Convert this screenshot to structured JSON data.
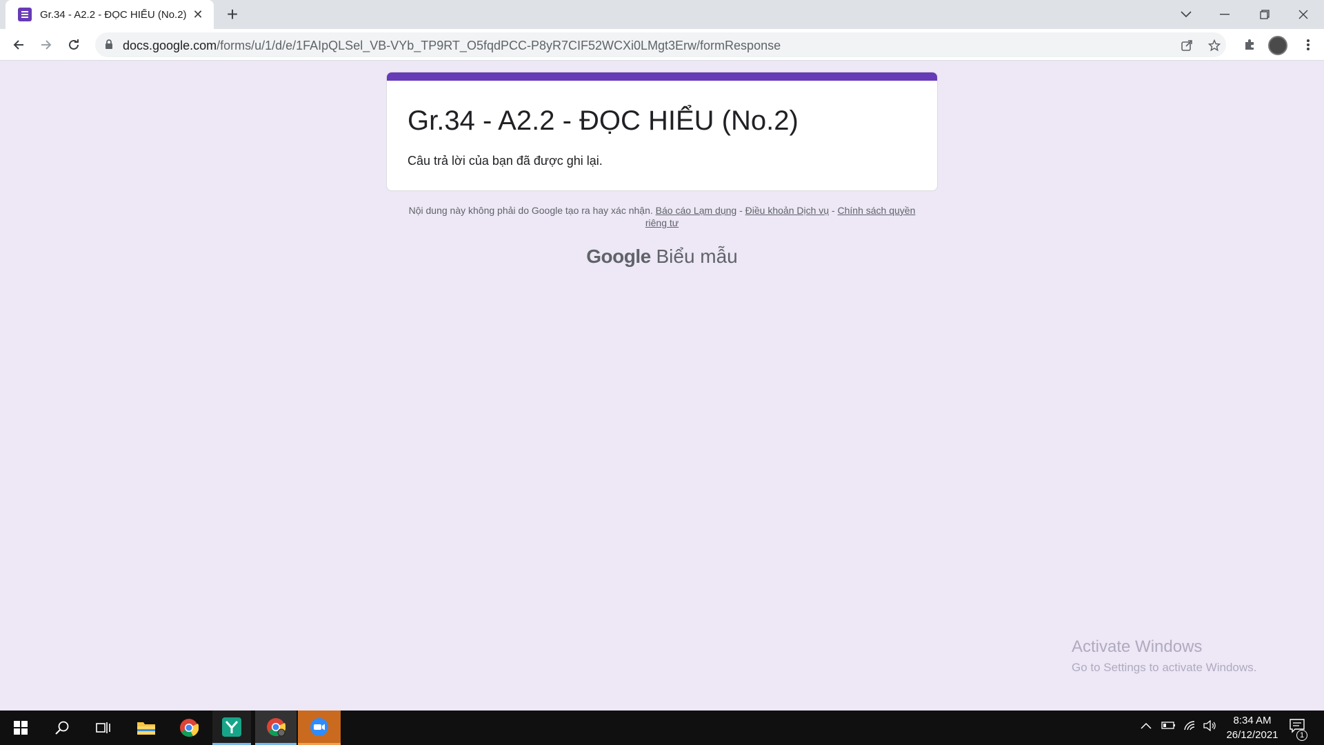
{
  "browser": {
    "tab_title": "Gr.34 - A2.2 - ĐỌC HIỂU (No.2)",
    "url_host": "docs.google.com",
    "url_path": "/forms/u/1/d/e/1FAIpQLSel_VB-VYb_TP9RT_O5fqdPCC-P8yR7CIF52WCXi0LMgt3Erw/formResponse"
  },
  "form": {
    "title": "Gr.34 - A2.2 - ĐỌC HIỂU (No.2)",
    "message": "Câu trả lời của bạn đã được ghi lại.",
    "accent_color": "#673ab7"
  },
  "footer": {
    "disclaimer": "Nội dung này không phải do Google tạo ra hay xác nhận.",
    "report_link": "Báo cáo Lạm dụng",
    "terms_link": "Điều khoản Dịch vụ",
    "privacy_link": "Chính sách quyền riêng tư",
    "separator": "-",
    "brand_google": "Google",
    "brand_product": "Biểu mẫu"
  },
  "watermark": {
    "line1": "Activate Windows",
    "line2": "Go to Settings to activate Windows."
  },
  "taskbar": {
    "time": "8:34 AM",
    "date": "26/12/2021",
    "notification_count": "1",
    "apps": [
      "windows-start-icon",
      "search-icon",
      "task-view-icon",
      "file-explorer-icon",
      "chrome-icon",
      "app-y-icon",
      "chrome-profile-icon",
      "zoom-icon"
    ]
  }
}
